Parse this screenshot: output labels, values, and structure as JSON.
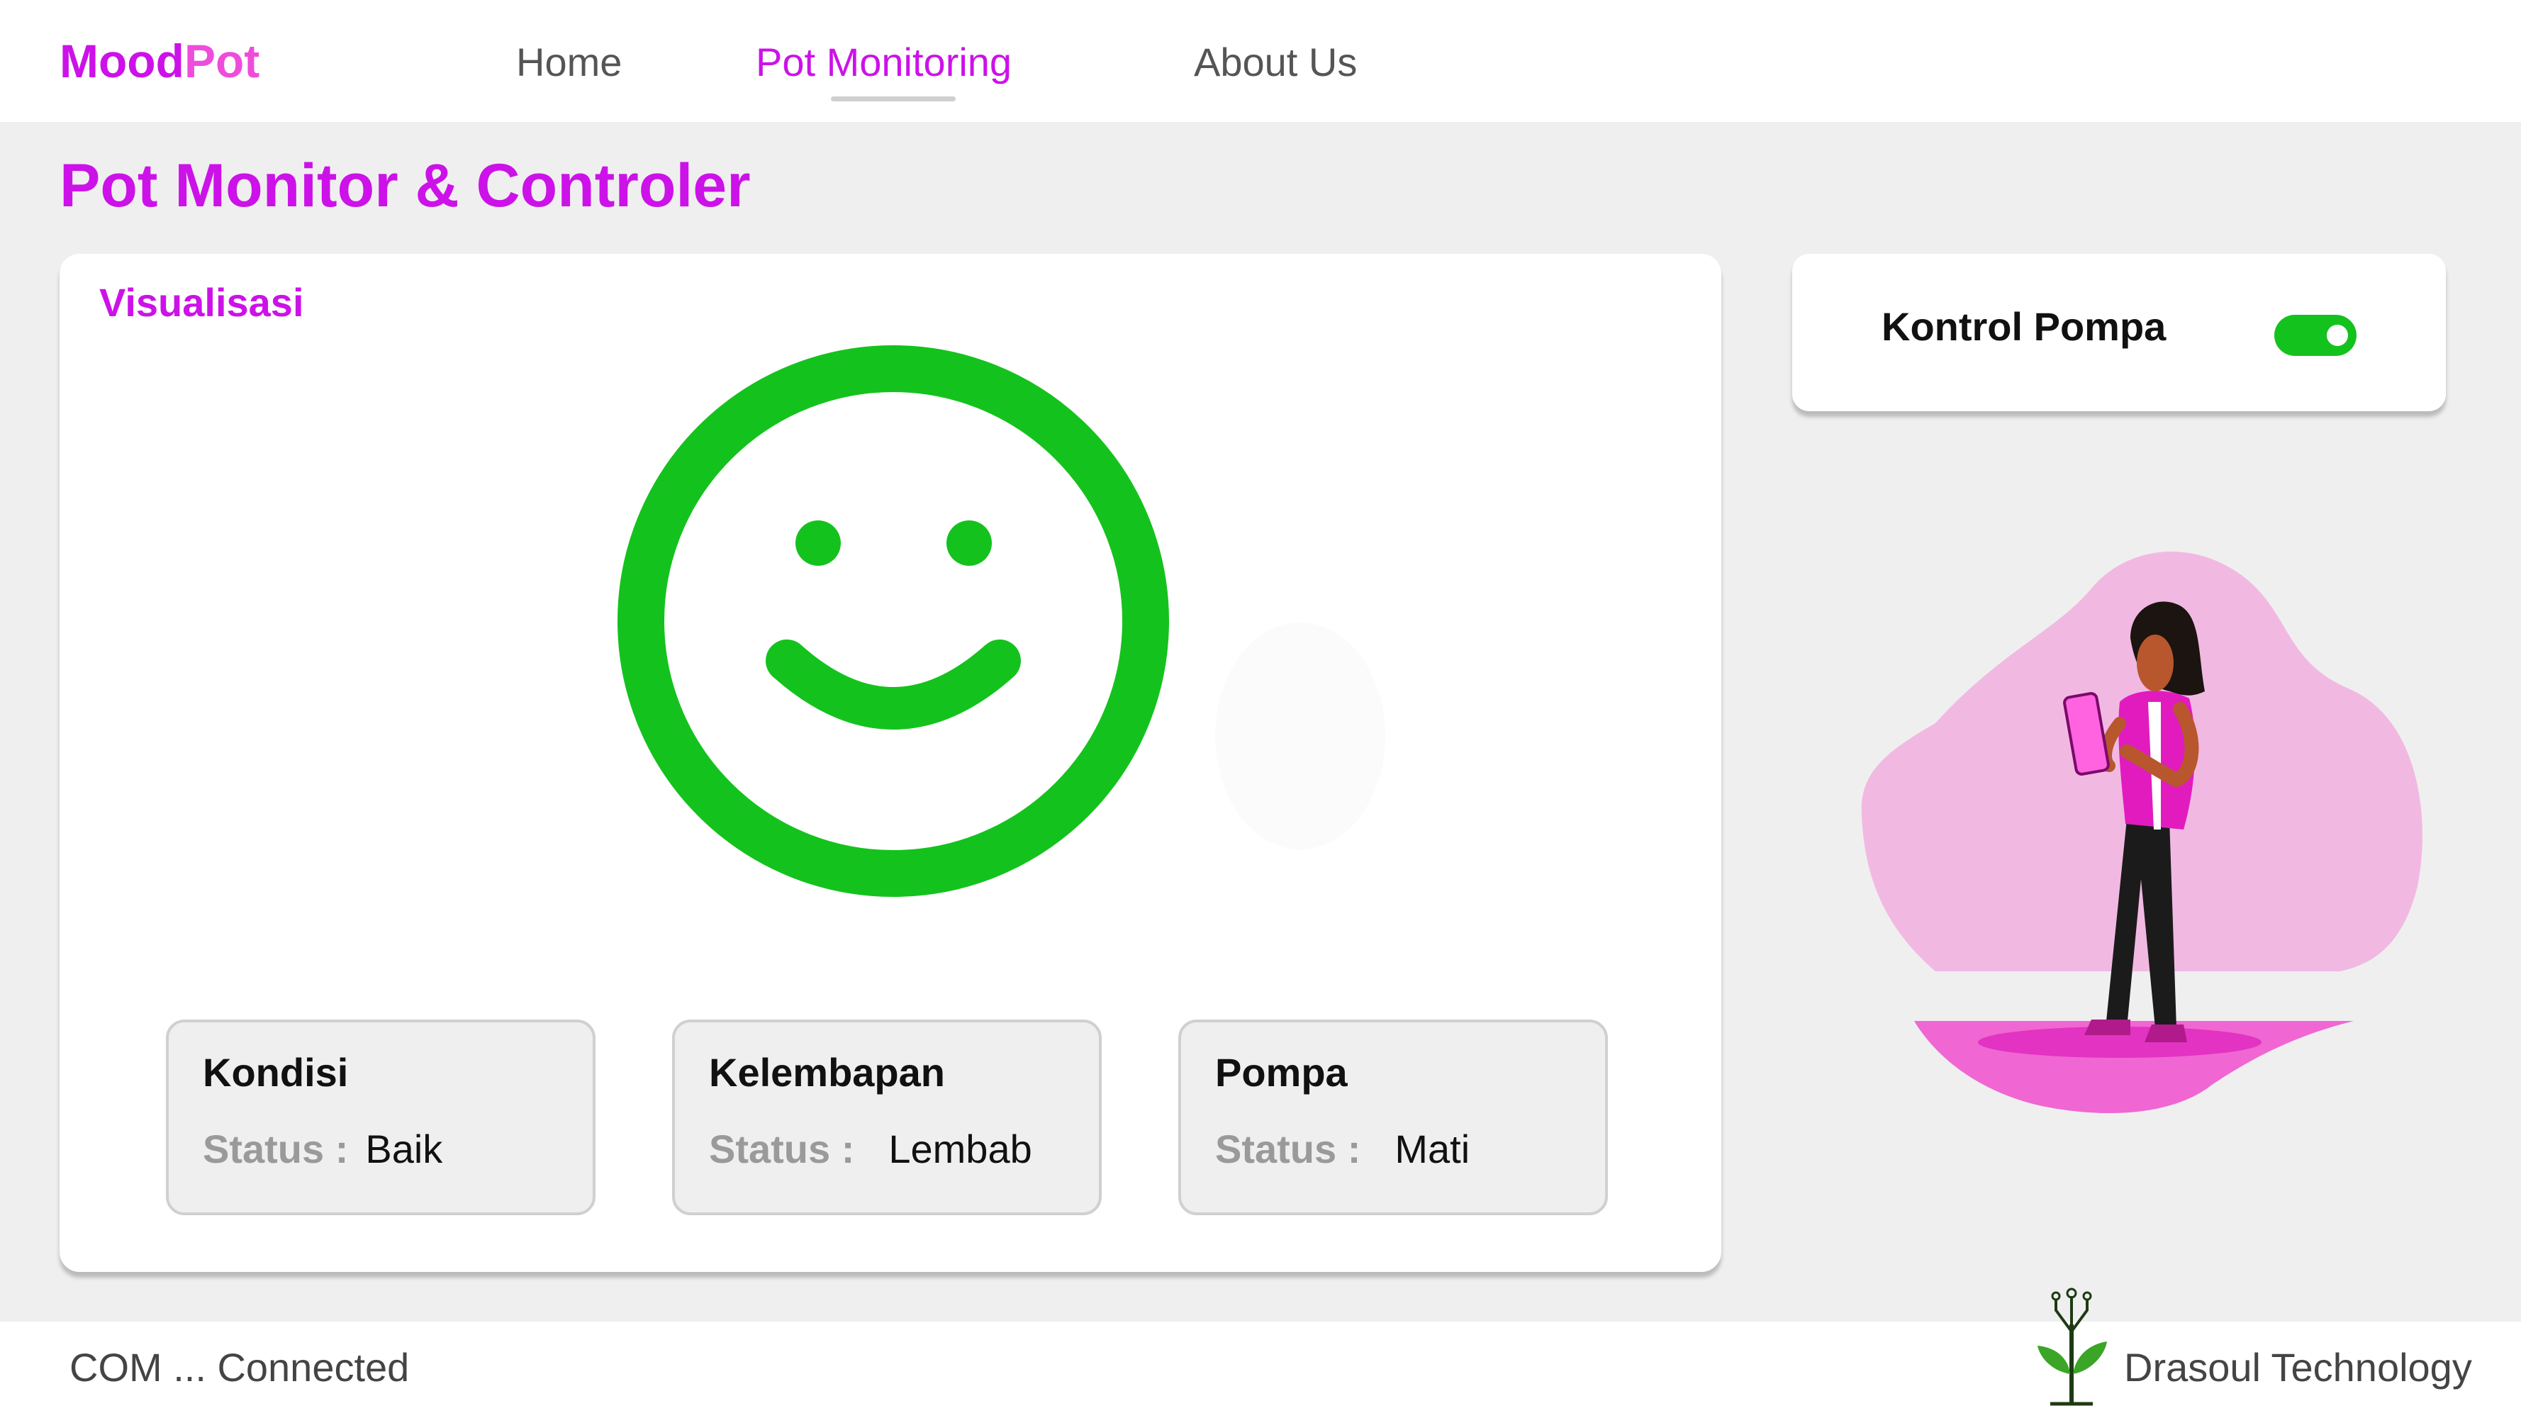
{
  "header": {
    "logo": {
      "part1": "Mood",
      "part2": "Pot"
    },
    "nav": [
      {
        "label": "Home"
      },
      {
        "label": "Pot Monitoring",
        "active": true
      },
      {
        "label": "About Us"
      }
    ]
  },
  "page": {
    "title": "Pot Monitor & Controler"
  },
  "visualization": {
    "title": "Visualisasi",
    "mood_icon": "happy-face-icon",
    "mood_color": "#14c21d",
    "cards": [
      {
        "title": "Kondisi",
        "status_label": "Status :",
        "status_value": "Baik"
      },
      {
        "title": "Kelembapan",
        "status_label": "Status :",
        "status_value": "Lembab"
      },
      {
        "title": "Pompa",
        "status_label": "Status :",
        "status_value": "Mati"
      }
    ]
  },
  "pump_control": {
    "label": "Kontrol Pompa",
    "toggle_on": true,
    "toggle_color": "#14c21d"
  },
  "footer": {
    "connection_status": "COM ... Connected",
    "company": "Drasoul Technology",
    "company_icon": "plant-logo-icon"
  },
  "colors": {
    "brand": "#cc12e8",
    "brand_secondary": "#ee4ddb",
    "background": "#efefef"
  }
}
